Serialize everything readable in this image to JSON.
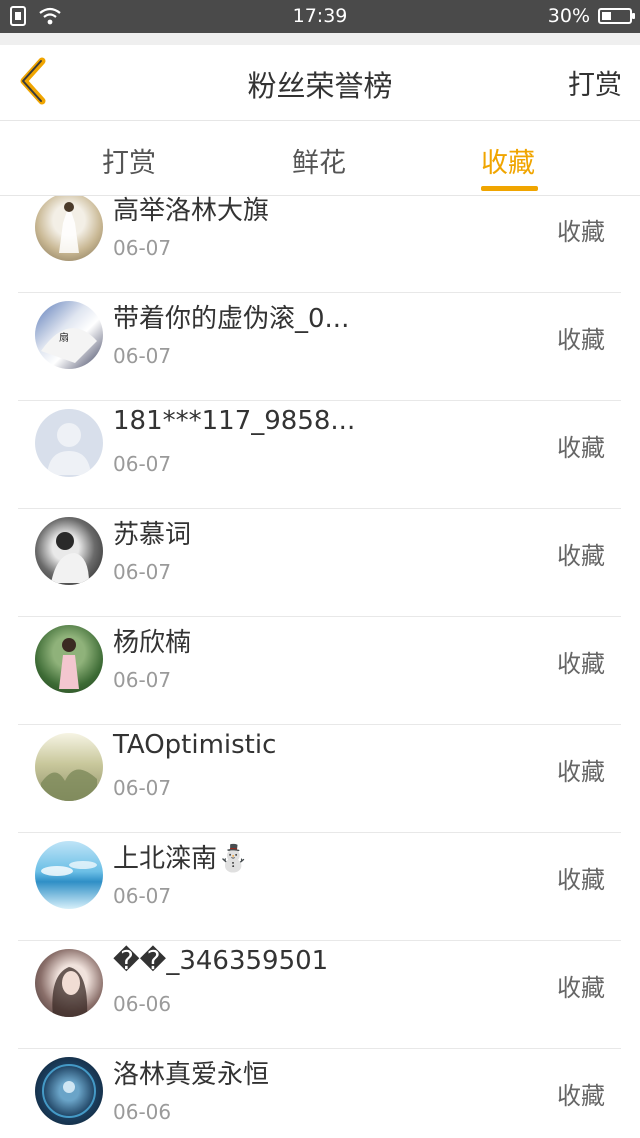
{
  "status_bar": {
    "time": "17:39",
    "battery_text": "30%",
    "battery_level": 0.3,
    "icons": [
      "sim-icon",
      "wifi-icon",
      "battery-icon"
    ]
  },
  "header": {
    "title": "粉丝荣誉榜",
    "back_icon": "chevron-left-icon",
    "action_label": "打赏",
    "accent_color": "#f0a500"
  },
  "tabs": [
    {
      "label": "打赏",
      "active": false
    },
    {
      "label": "鲜花",
      "active": false
    },
    {
      "label": "收藏",
      "active": true
    }
  ],
  "fans": [
    {
      "name": "高举洛林大旗",
      "date": "06-07",
      "action": "收藏"
    },
    {
      "name": "带着你的虚伪滚_0...",
      "date": "06-07",
      "action": "收藏"
    },
    {
      "name": "181***117_9858...",
      "date": "06-07",
      "action": "收藏"
    },
    {
      "name": "苏慕词",
      "date": "06-07",
      "action": "收藏"
    },
    {
      "name": "杨欣楠",
      "date": "06-07",
      "action": "收藏"
    },
    {
      "name": "TAOptimistic",
      "date": "06-07",
      "action": "收藏"
    },
    {
      "name": "上北滦南⛄",
      "date": "06-07",
      "action": "收藏"
    },
    {
      "name": "��_346359501",
      "date": "06-06",
      "action": "收藏"
    },
    {
      "name": "洛林真爱永恒",
      "date": "06-06",
      "action": "收藏"
    }
  ]
}
